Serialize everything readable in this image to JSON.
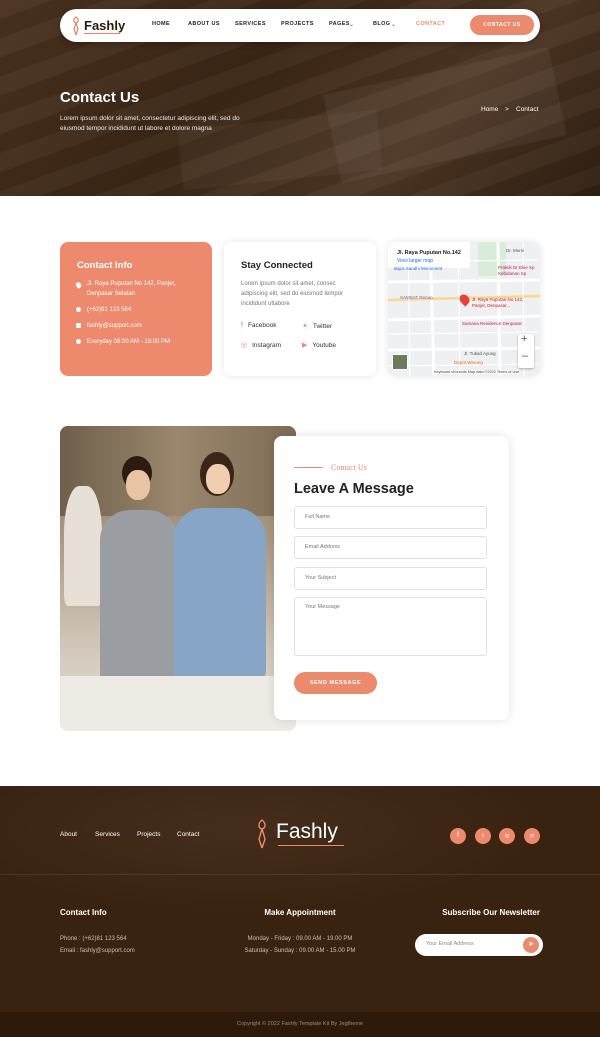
{
  "brand": {
    "name": "Fashly",
    "accent": "#ec8a6e"
  },
  "nav": {
    "items": [
      {
        "label": "HOME"
      },
      {
        "label": "ABOUT US"
      },
      {
        "label": "SERVICES"
      },
      {
        "label": "PROJECTS"
      },
      {
        "label": "PAGES"
      },
      {
        "label": "BLOG"
      },
      {
        "label": "CONTACT",
        "active": true
      }
    ],
    "cta": "CONTACT US"
  },
  "hero": {
    "title": "Contact Us",
    "description": "Lorem ipsum dolor sit amet, consectetur adipiscing elit, sed do eiusmod tempor incididunt ut labore et dolore magna",
    "breadcrumb": {
      "home": "Home",
      "sep": ">",
      "current": "Contact"
    }
  },
  "contact_info": {
    "title": "Contact Info",
    "address": "Jl. Raya Puputan No 142, Panjer, Denpasar Selatan",
    "phone": "(+62)81 123 564",
    "email": "fashly@support.com",
    "hours": "Everyday 08:00 AM - 18:00 PM"
  },
  "stay_connected": {
    "title": "Stay Connected",
    "text": "Lorem ipsum dolor sit amet, consec adipiscing elit, sed do eiusmod tempor incididunt utlabore",
    "links": {
      "facebook": "Facebook",
      "twitter": "Twitter",
      "instagram": "Instagram",
      "youtube": "Youtube"
    }
  },
  "map": {
    "place_title": "Jl. Raya Puputan No.142",
    "larger_map": "View larger map",
    "labels": {
      "monument": "Bajra Sandhi Monument",
      "samsat": "SAMSAT Renon",
      "pin": "Jl. Raya Puputan No 142, Panjer, Denpasar...",
      "residence": "Samana Residence Denpasar",
      "tukad": "Jl. Tukad Ayung",
      "warung": "Depot Warung",
      "praktik": "Praktik Dr Ekie Sp Kebidanan Sp",
      "murni": "Dr. Murni"
    },
    "attribution": "Keyboard shortcuts   Map data ©2022   Terms of Use"
  },
  "message": {
    "eyebrow": "Contact Us",
    "title": "Leave A Message",
    "fields": {
      "name": "Full Name",
      "email": "Email Address",
      "subject": "Your Subject",
      "message": "Your Message"
    },
    "submit": "SEND MESSAGE"
  },
  "footer": {
    "links": {
      "about": "About",
      "services": "Services",
      "projects": "Projects",
      "contact": "Contact"
    },
    "logo": "Fashly",
    "social": {
      "facebook": "f",
      "twitter": "t",
      "instagram": "ig",
      "youtube": "yt"
    },
    "contact": {
      "title": "Contact Info",
      "phone": "Phone : (+62)81 123 564",
      "email": "Email : fashly@support.com"
    },
    "appointment": {
      "title": "Make Appointment",
      "weekday": "Monday - Friday : 09.00 AM - 19.00 PM",
      "weekend": "Saturday - Sunday : 09.00 AM - 15.00 PM"
    },
    "newsletter": {
      "title": "Subscribe Our Newsletter",
      "placeholder": "Your Email Address"
    },
    "copyright": "Copyright © 2022 Fashly Template Kit By Jegtheme"
  }
}
